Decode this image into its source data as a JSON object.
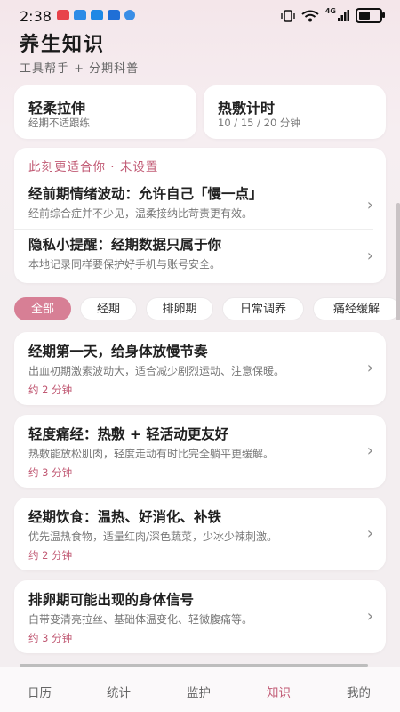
{
  "status_bar": {
    "time": "2:38",
    "notification_icons": [
      {
        "name": "mail-app-icon",
        "color": "#e8424a"
      },
      {
        "name": "paper-plane-app-icon",
        "color": "#2d8be6"
      },
      {
        "name": "bilibili-app-icon",
        "color": "#1e88e5"
      },
      {
        "name": "chat-app-icon",
        "color": "#1f6fd6"
      },
      {
        "name": "gear-app-icon",
        "color": "#3a8ee6"
      }
    ],
    "network": "4G"
  },
  "header": {
    "title": "养生知识",
    "subtitle": "工具帮手 + 分期科普"
  },
  "tools": [
    {
      "title": "轻柔拉伸",
      "subtitle": "经期不适跟练"
    },
    {
      "title": "热敷计时",
      "subtitle": "10 / 15 / 20 分钟"
    }
  ],
  "recommend": {
    "header": "此刻更适合你 · 未设置",
    "items": [
      {
        "title": "经前期情绪波动：允许自己「慢一点」",
        "desc": "经前综合症并不少见，温柔接纳比苛责更有效。"
      },
      {
        "title": "隐私小提醒：经期数据只属于你",
        "desc": "本地记录同样要保护好手机与账号安全。"
      }
    ]
  },
  "filters": {
    "chips": [
      "全部",
      "经期",
      "排卵期",
      "日常调养",
      "痛经缓解"
    ],
    "active_index": 0
  },
  "articles": [
    {
      "title": "经期第一天，给身体放慢节奏",
      "desc": "出血初期激素波动大，适合减少剧烈运动、注意保暖。",
      "time": "约 2 分钟"
    },
    {
      "title": "轻度痛经：热敷 + 轻活动更友好",
      "desc": "热敷能放松肌肉，轻度走动有时比完全躺平更缓解。",
      "time": "约 3 分钟"
    },
    {
      "title": "经期饮食：温热、好消化、补铁",
      "desc": "优先温热食物，适量红肉/深色蔬菜，少冰少辣刺激。",
      "time": "约 2 分钟"
    },
    {
      "title": "排卵期可能出现的身体信号",
      "desc": "白带变清亮拉丝、基础体温变化、轻微腹痛等。",
      "time": "约 3 分钟"
    }
  ],
  "tabbar": {
    "tabs": [
      "日历",
      "统计",
      "监护",
      "知识",
      "我的"
    ],
    "active_index": 3
  },
  "colors": {
    "accent": "#c15a74",
    "chip_active": "#d77f95"
  }
}
